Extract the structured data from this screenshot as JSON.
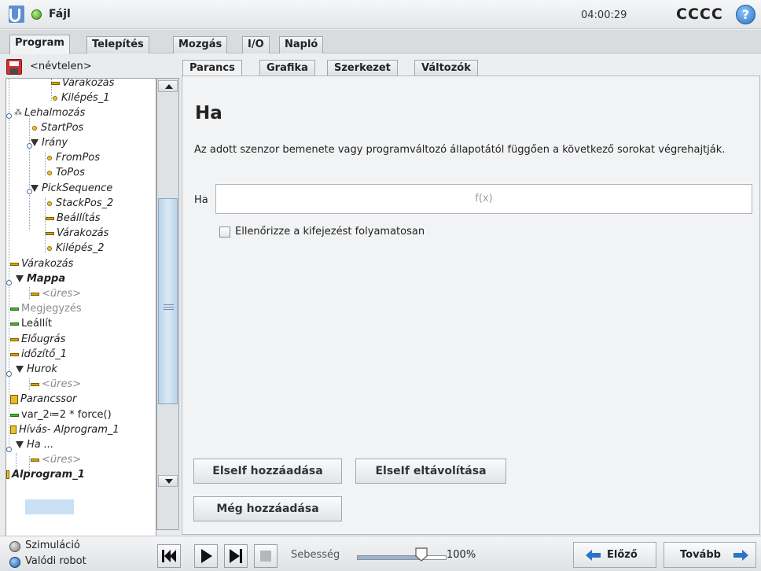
{
  "titlebar": {
    "file_label": "Fájl",
    "clock": "04:00:29",
    "robot_name": "CCCC",
    "help_glyph": "?"
  },
  "main_tabs": [
    "Program",
    "Telepítés",
    "Mozgás",
    "I/O",
    "Napló"
  ],
  "left": {
    "program_name": "<névtelen>",
    "tree": [
      {
        "label": "Várakozás",
        "icon": "wait-icon"
      },
      {
        "label": "Kilépés_1",
        "icon": "waypoint-icon"
      },
      {
        "label": "Lehalmozás",
        "icon": "stack-icon"
      },
      {
        "label": "StartPos",
        "icon": "waypoint-icon"
      },
      {
        "label": "Irány",
        "icon": "folder-icon"
      },
      {
        "label": "FromPos",
        "icon": "waypoint-icon"
      },
      {
        "label": "ToPos",
        "icon": "waypoint-icon"
      },
      {
        "label": "PickSequence",
        "icon": "folder-icon"
      },
      {
        "label": "StackPos_2",
        "icon": "waypoint-icon"
      },
      {
        "label": "Beállítás",
        "icon": "set-icon"
      },
      {
        "label": "Várakozás",
        "icon": "wait-icon"
      },
      {
        "label": "Kilépés_2",
        "icon": "waypoint-icon"
      },
      {
        "label": "Várakozás",
        "icon": "wait-icon"
      },
      {
        "label": "Mappa",
        "icon": "folder-icon"
      },
      {
        "label": "<üres>",
        "icon": "empty-icon"
      },
      {
        "label": "Megjegyzés",
        "icon": "comment-icon"
      },
      {
        "label": "Leállít",
        "icon": "halt-icon"
      },
      {
        "label": "Előugrás",
        "icon": "popup-icon"
      },
      {
        "label": "időzítő_1",
        "icon": "timer-icon"
      },
      {
        "label": "Hurok",
        "icon": "loop-icon"
      },
      {
        "label": "<üres>",
        "icon": "empty-icon"
      },
      {
        "label": "Parancssor",
        "icon": "script-icon"
      },
      {
        "label": "var_2≔2 * force()",
        "icon": "assignment-icon"
      },
      {
        "label": "Hívás- Alprogram_1",
        "icon": "call-icon"
      },
      {
        "label": "Ha ...",
        "icon": "if-icon"
      },
      {
        "label": "<üres>",
        "icon": "empty-icon"
      },
      {
        "label": "Alprogram_1",
        "icon": "subprogram-icon"
      }
    ]
  },
  "sub_tabs": [
    "Parancs",
    "Grafika",
    "Szerkezet",
    "Változók"
  ],
  "command": {
    "heading": "Ha",
    "description": "Az adott szenzor bemenete vagy programváltozó állapotától függően a következő sorokat végrehajtják.",
    "if_label": "Ha",
    "expression_placeholder": "f(x)",
    "checkbox_label": "Ellenőrizze a kifejezést folyamatosan",
    "checkbox_checked": false,
    "btn_add_elseif": "ElseIf hozzáadása",
    "btn_remove_elseif": "ElseIf eltávolítása",
    "btn_add_else": "Még hozzáadása"
  },
  "bottom": {
    "mode_sim": "Szimuláció",
    "mode_real": "Valódi robot",
    "speed_label": "Sebesség",
    "speed_value": "100%",
    "speed_fraction": 0.72,
    "prev_label": "Előző",
    "next_label": "Tovább"
  },
  "colors": {
    "accent_blue": "#2a74c8",
    "selection": "#c9dff4",
    "waypoint_yellow": "#f1c232",
    "green_status": "#3d9a1a"
  }
}
